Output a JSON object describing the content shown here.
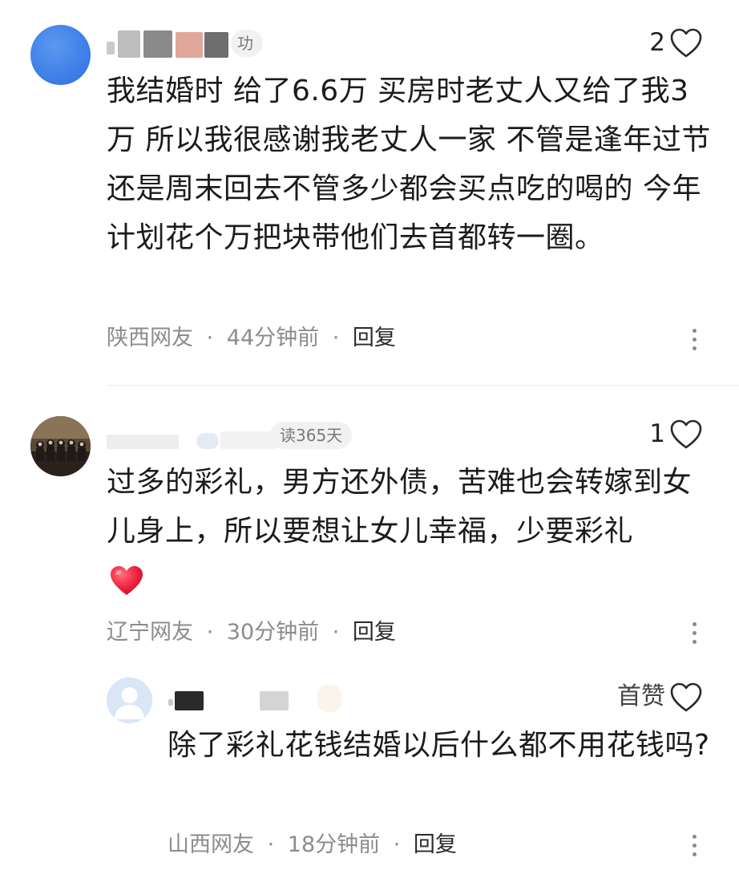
{
  "comments": [
    {
      "name_badge": "功",
      "likes": "2",
      "content": "我结婚时 给了6.6万 买房时老丈人又给了我3万 所以我很感谢我老丈人一家 不管是逢年过节 还是周末回去不管多少都会买点吃的喝的 今年计划花个万把块带他们去首都转一圈。",
      "location": "陕西网友",
      "time": "44分钟前",
      "reply": "回复"
    },
    {
      "name_badge": "读365天",
      "likes": "1",
      "content": "过多的彩礼，男方还外债，苦难也会转嫁到女儿身上，所以要想让女儿幸福，少要彩礼",
      "emoji": "❤",
      "location": "辽宁网友",
      "time": "30分钟前",
      "reply": "回复"
    },
    {
      "likes": "首赞",
      "content": "除了彩礼花钱结婚以后什么都不用花钱吗?",
      "location": "山西网友",
      "time": "18分钟前",
      "reply": "回复"
    }
  ],
  "separator": "·",
  "colors": {
    "heart": "#f0243f",
    "avatar_blue": "#3f82e8",
    "meta": "#8c8c8c"
  }
}
